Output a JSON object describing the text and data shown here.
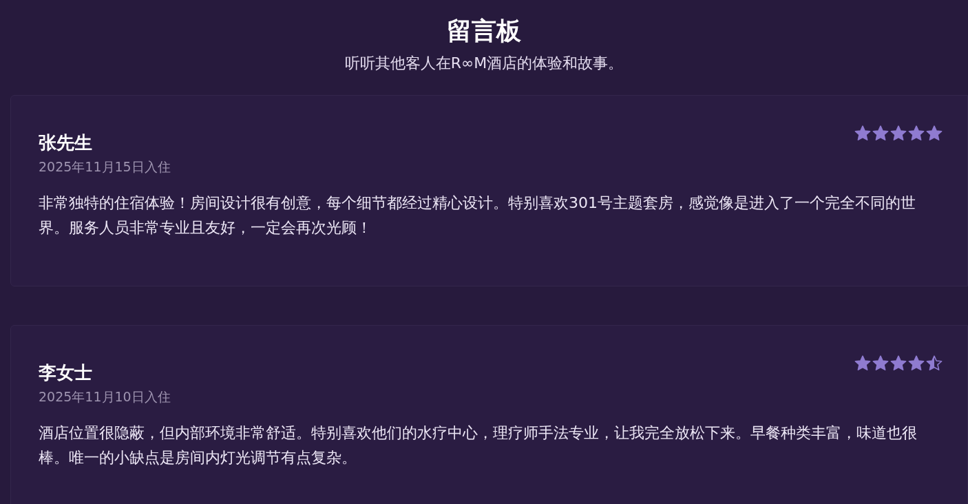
{
  "header": {
    "title": "留言板",
    "subtitle": "听听其他客人在R∞M酒店的体验和故事。"
  },
  "reviews": [
    {
      "name": "张先生",
      "date": "2025年11月15日入住",
      "stars": 5,
      "text": "非常独特的住宿体验！房间设计很有创意，每个细节都经过精心设计。特别喜欢301号主题套房，感觉像是进入了一个完全不同的世界。服务人员非常专业且友好，一定会再次光顾！"
    },
    {
      "name": "李女士",
      "date": "2025年11月10日入住",
      "stars": 4.5,
      "text": "酒店位置很隐蔽，但内部环境非常舒适。特别喜欢他们的水疗中心，理疗师手法专业，让我完全放松下来。早餐种类丰富，味道也很棒。唯一的小缺点是房间内灯光调节有点复杂。"
    }
  ]
}
